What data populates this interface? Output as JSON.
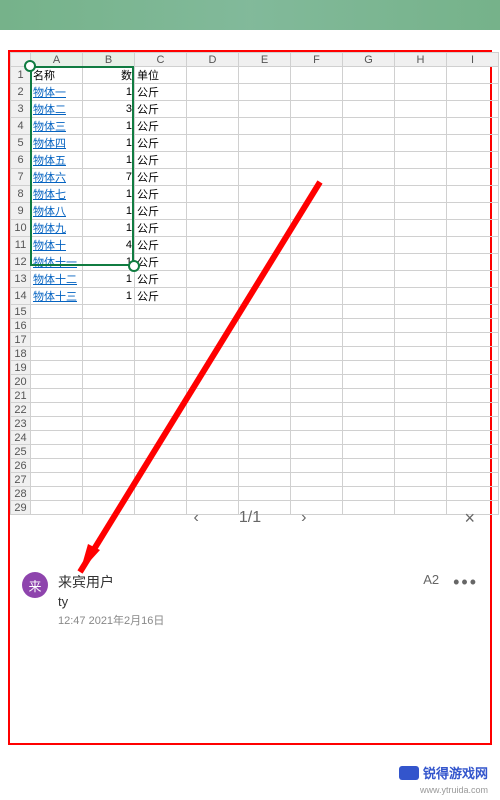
{
  "columns": [
    "A",
    "B",
    "C",
    "D",
    "E",
    "F",
    "G",
    "H",
    "I"
  ],
  "header_row": {
    "name": "名称",
    "qty": "数量",
    "unit": "单位"
  },
  "rows": [
    {
      "n": "物体一",
      "q": "1",
      "u": "公斤"
    },
    {
      "n": "物体二",
      "q": "3",
      "u": "公斤"
    },
    {
      "n": "物体三",
      "q": "1",
      "u": "公斤"
    },
    {
      "n": "物体四",
      "q": "1",
      "u": "公斤"
    },
    {
      "n": "物体五",
      "q": "1",
      "u": "公斤"
    },
    {
      "n": "物体六",
      "q": "7",
      "u": "公斤"
    },
    {
      "n": "物体七",
      "q": "1",
      "u": "公斤"
    },
    {
      "n": "物体八",
      "q": "1",
      "u": "公斤"
    },
    {
      "n": "物体九",
      "q": "1",
      "u": "公斤"
    },
    {
      "n": "物体十",
      "q": "4",
      "u": "公斤"
    },
    {
      "n": "物体十一",
      "q": "1",
      "u": "公斤"
    },
    {
      "n": "物体十二",
      "q": "1",
      "u": "公斤"
    },
    {
      "n": "物体十三",
      "q": "1",
      "u": "公斤"
    }
  ],
  "empty_rows_start": 15,
  "empty_rows_end": 29,
  "pager": {
    "prev": "‹",
    "label": "1/1",
    "next": "›",
    "close": "×"
  },
  "comment": {
    "avatar": "来",
    "user": "来宾用户",
    "text": "ty",
    "date": "12:47 2021年2月16日",
    "cell": "A2",
    "more": "•••"
  },
  "watermark": {
    "text": "锐得游戏网",
    "url": "www.ytruida.com"
  }
}
